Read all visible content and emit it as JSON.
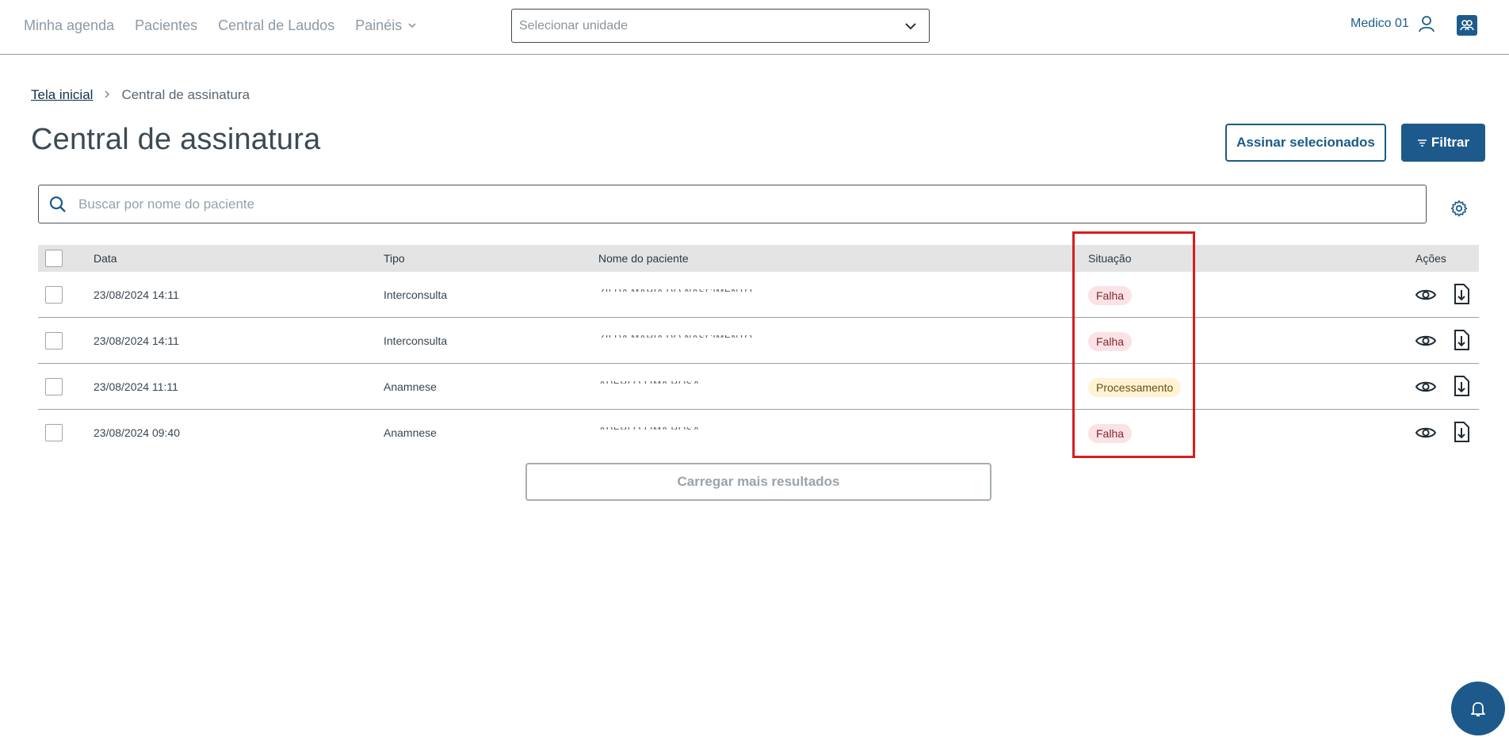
{
  "nav": {
    "items": [
      {
        "label": "Minha agenda"
      },
      {
        "label": "Pacientes"
      },
      {
        "label": "Central de Laudos"
      },
      {
        "label": "Painéis",
        "has_dropdown": true
      }
    ],
    "unit_select": {
      "placeholder": "Selecionar unidade"
    },
    "user": {
      "name": "Medico 01"
    }
  },
  "breadcrumb": {
    "home": "Tela inicial",
    "current": "Central de assinatura"
  },
  "page": {
    "title": "Central de assinatura",
    "sign_selected_label": "Assinar selecionados",
    "filter_label": "Filtrar"
  },
  "search": {
    "placeholder": "Buscar por nome do paciente"
  },
  "table": {
    "headers": {
      "date": "Data",
      "type": "Tipo",
      "patient": "Nome do paciente",
      "status": "Situação",
      "actions": "Ações"
    },
    "rows": [
      {
        "date": "23/08/2024 14:11",
        "type": "Interconsulta",
        "patient": "ZILDA MARIA DO NASCIMENTO",
        "status": "Falha",
        "status_kind": "fail"
      },
      {
        "date": "23/08/2024 14:11",
        "type": "Interconsulta",
        "patient": "ZILDA MARIA DO NASCIMENTO",
        "status": "Falha",
        "status_kind": "fail"
      },
      {
        "date": "23/08/2024 11:11",
        "type": "Anamnese",
        "patient": "ADERLO LIMA ROSA",
        "status": "Processamento",
        "status_kind": "processing"
      },
      {
        "date": "23/08/2024 09:40",
        "type": "Anamnese",
        "patient": "ADERLO LIMA ROSA",
        "status": "Falha",
        "status_kind": "fail"
      }
    ]
  },
  "load_more_label": "Carregar mais resultados",
  "colors": {
    "brand": "#1d5a8b",
    "fail_bg": "#fbe2e4",
    "processing_bg": "#fff3d4",
    "highlight": "#d91d1d"
  },
  "icons": [
    "chevron-down-icon",
    "user-icon",
    "app-switch-icon",
    "chevron-right-icon",
    "filter-icon",
    "search-icon",
    "gear-icon",
    "eye-icon",
    "download-file-icon",
    "bell-icon"
  ]
}
